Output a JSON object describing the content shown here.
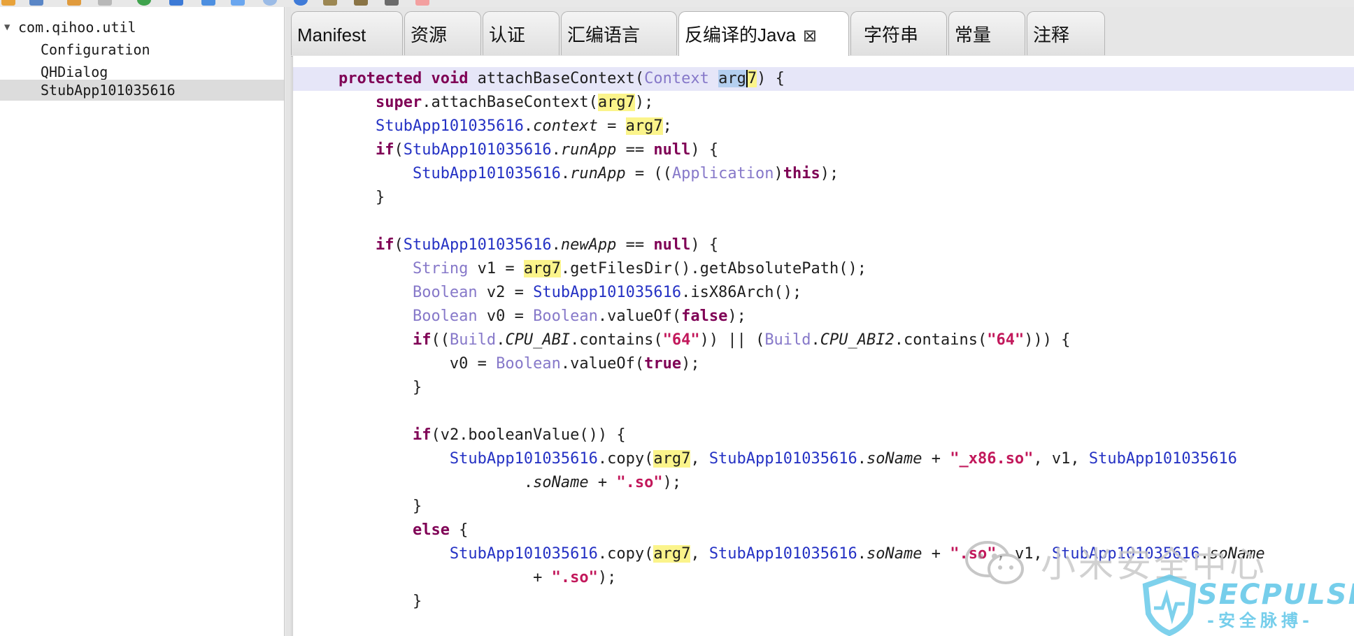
{
  "toolbar": {
    "icons": [
      "folder-icon",
      "save-icon",
      "pencil-icon",
      "clipboard-icon",
      "refresh-icon",
      "down-arrow-icon",
      "back-icon",
      "forward-icon",
      "info-icon",
      "info-icon",
      "tool-icon",
      "tool-icon",
      "settings-icon",
      "image-icon"
    ]
  },
  "tree": {
    "items": [
      {
        "label": "com.qihoo.util",
        "expanded": true
      },
      {
        "label": "Configuration"
      },
      {
        "label": "QHDialog"
      },
      {
        "label": "StubApp101035616",
        "selected": true
      }
    ]
  },
  "tabs": [
    {
      "label": "Manifest"
    },
    {
      "label": "资源"
    },
    {
      "label": "认证"
    },
    {
      "label": "汇编语言"
    },
    {
      "label": "反编译的Java",
      "active": true,
      "close_icon": "close-icon"
    },
    {
      "label": "字符串"
    },
    {
      "label": "常量"
    },
    {
      "label": "注释"
    }
  ],
  "code": {
    "lines": [
      {
        "tokens": [
          {
            "text": "            ",
            "c": ""
          }
        ]
      },
      {
        "tokens": [
          {
            "text": "    ",
            "c": ""
          },
          {
            "text": "protected",
            "c": "kw"
          },
          {
            "text": " ",
            "c": ""
          },
          {
            "text": "void",
            "c": "kw"
          },
          {
            "text": " attachBaseContext(",
            "c": ""
          },
          {
            "text": "Context",
            "c": "typ"
          },
          {
            "text": " ",
            "c": ""
          },
          {
            "text": "arg",
            "c": "sel"
          },
          {
            "text": "7",
            "c": "hl caret"
          },
          {
            "text": ") {",
            "c": ""
          }
        ],
        "current": true
      },
      {
        "tokens": [
          {
            "text": "        ",
            "c": ""
          },
          {
            "text": "super",
            "c": "kw"
          },
          {
            "text": ".attachBaseContext(",
            "c": ""
          },
          {
            "text": "arg7",
            "c": "hl"
          },
          {
            "text": ");",
            "c": ""
          }
        ]
      },
      {
        "tokens": [
          {
            "text": "        ",
            "c": ""
          },
          {
            "text": "StubApp101035616",
            "c": "cls"
          },
          {
            "text": ".",
            "c": ""
          },
          {
            "text": "context",
            "c": "fld"
          },
          {
            "text": " = ",
            "c": ""
          },
          {
            "text": "arg7",
            "c": "hl"
          },
          {
            "text": ";",
            "c": ""
          }
        ]
      },
      {
        "tokens": [
          {
            "text": "        ",
            "c": ""
          },
          {
            "text": "if",
            "c": "kw"
          },
          {
            "text": "(",
            "c": ""
          },
          {
            "text": "StubApp101035616",
            "c": "cls"
          },
          {
            "text": ".",
            "c": ""
          },
          {
            "text": "runApp",
            "c": "fld"
          },
          {
            "text": " == ",
            "c": ""
          },
          {
            "text": "null",
            "c": "kw"
          },
          {
            "text": ") {",
            "c": ""
          }
        ]
      },
      {
        "tokens": [
          {
            "text": "            ",
            "c": ""
          },
          {
            "text": "StubApp101035616",
            "c": "cls"
          },
          {
            "text": ".",
            "c": ""
          },
          {
            "text": "runApp",
            "c": "fld"
          },
          {
            "text": " = ((",
            "c": ""
          },
          {
            "text": "Application",
            "c": "typ"
          },
          {
            "text": ")",
            "c": ""
          },
          {
            "text": "this",
            "c": "kw"
          },
          {
            "text": ");",
            "c": ""
          }
        ]
      },
      {
        "tokens": [
          {
            "text": "        }",
            "c": ""
          }
        ]
      },
      {
        "tokens": [
          {
            "text": "",
            "c": ""
          }
        ]
      },
      {
        "tokens": [
          {
            "text": "        ",
            "c": ""
          },
          {
            "text": "if",
            "c": "kw"
          },
          {
            "text": "(",
            "c": ""
          },
          {
            "text": "StubApp101035616",
            "c": "cls"
          },
          {
            "text": ".",
            "c": ""
          },
          {
            "text": "newApp",
            "c": "fld"
          },
          {
            "text": " == ",
            "c": ""
          },
          {
            "text": "null",
            "c": "kw"
          },
          {
            "text": ") {",
            "c": ""
          }
        ]
      },
      {
        "tokens": [
          {
            "text": "            ",
            "c": ""
          },
          {
            "text": "String",
            "c": "typ"
          },
          {
            "text": " v1 = ",
            "c": ""
          },
          {
            "text": "arg7",
            "c": "hl"
          },
          {
            "text": ".getFilesDir().getAbsolutePath();",
            "c": ""
          }
        ]
      },
      {
        "tokens": [
          {
            "text": "            ",
            "c": ""
          },
          {
            "text": "Boolean",
            "c": "typ"
          },
          {
            "text": " v2 = ",
            "c": ""
          },
          {
            "text": "StubApp101035616",
            "c": "cls"
          },
          {
            "text": ".isX86Arch();",
            "c": ""
          }
        ]
      },
      {
        "tokens": [
          {
            "text": "            ",
            "c": ""
          },
          {
            "text": "Boolean",
            "c": "typ"
          },
          {
            "text": " v0 = ",
            "c": ""
          },
          {
            "text": "Boolean",
            "c": "typ"
          },
          {
            "text": ".valueOf(",
            "c": ""
          },
          {
            "text": "false",
            "c": "kw"
          },
          {
            "text": ");",
            "c": ""
          }
        ]
      },
      {
        "tokens": [
          {
            "text": "            ",
            "c": ""
          },
          {
            "text": "if",
            "c": "kw"
          },
          {
            "text": "((",
            "c": ""
          },
          {
            "text": "Build",
            "c": "typ"
          },
          {
            "text": ".",
            "c": ""
          },
          {
            "text": "CPU_ABI",
            "c": "fld"
          },
          {
            "text": ".contains(",
            "c": ""
          },
          {
            "text": "\"64\"",
            "c": "str"
          },
          {
            "text": ")) || (",
            "c": ""
          },
          {
            "text": "Build",
            "c": "typ"
          },
          {
            "text": ".",
            "c": ""
          },
          {
            "text": "CPU_ABI2",
            "c": "fld"
          },
          {
            "text": ".contains(",
            "c": ""
          },
          {
            "text": "\"64\"",
            "c": "str"
          },
          {
            "text": "))) {",
            "c": ""
          }
        ]
      },
      {
        "tokens": [
          {
            "text": "                v0 = ",
            "c": ""
          },
          {
            "text": "Boolean",
            "c": "typ"
          },
          {
            "text": ".valueOf(",
            "c": ""
          },
          {
            "text": "true",
            "c": "kw"
          },
          {
            "text": ");",
            "c": ""
          }
        ]
      },
      {
        "tokens": [
          {
            "text": "            }",
            "c": ""
          }
        ]
      },
      {
        "tokens": [
          {
            "text": "",
            "c": ""
          }
        ]
      },
      {
        "tokens": [
          {
            "text": "            ",
            "c": ""
          },
          {
            "text": "if",
            "c": "kw"
          },
          {
            "text": "(v2.booleanValue()) {",
            "c": ""
          }
        ]
      },
      {
        "tokens": [
          {
            "text": "                ",
            "c": ""
          },
          {
            "text": "StubApp101035616",
            "c": "cls"
          },
          {
            "text": ".copy(",
            "c": ""
          },
          {
            "text": "arg7",
            "c": "hl"
          },
          {
            "text": ", ",
            "c": ""
          },
          {
            "text": "StubApp101035616",
            "c": "cls"
          },
          {
            "text": ".",
            "c": ""
          },
          {
            "text": "soName",
            "c": "fld"
          },
          {
            "text": " + ",
            "c": ""
          },
          {
            "text": "\"_x86.so\"",
            "c": "str"
          },
          {
            "text": ", v1, ",
            "c": ""
          },
          {
            "text": "StubApp101035616",
            "c": "cls"
          }
        ]
      },
      {
        "tokens": [
          {
            "text": "                        .",
            "c": ""
          },
          {
            "text": "soName",
            "c": "fld"
          },
          {
            "text": " + ",
            "c": ""
          },
          {
            "text": "\".so\"",
            "c": "str"
          },
          {
            "text": ");",
            "c": ""
          }
        ]
      },
      {
        "tokens": [
          {
            "text": "            }",
            "c": ""
          }
        ]
      },
      {
        "tokens": [
          {
            "text": "            ",
            "c": ""
          },
          {
            "text": "else",
            "c": "kw"
          },
          {
            "text": " {",
            "c": ""
          }
        ]
      },
      {
        "tokens": [
          {
            "text": "                ",
            "c": ""
          },
          {
            "text": "StubApp101035616",
            "c": "cls"
          },
          {
            "text": ".copy(",
            "c": ""
          },
          {
            "text": "arg7",
            "c": "hl"
          },
          {
            "text": ", ",
            "c": ""
          },
          {
            "text": "StubApp101035616",
            "c": "cls"
          },
          {
            "text": ".",
            "c": ""
          },
          {
            "text": "soName",
            "c": "fld"
          },
          {
            "text": " + ",
            "c": ""
          },
          {
            "text": "\".so\"",
            "c": "str"
          },
          {
            "text": ", v1, ",
            "c": ""
          },
          {
            "text": "StubApp101035616",
            "c": "cls"
          },
          {
            "text": ".",
            "c": ""
          },
          {
            "text": "soName",
            "c": "fld"
          }
        ]
      },
      {
        "tokens": [
          {
            "text": "                         + ",
            "c": ""
          },
          {
            "text": "\".so\"",
            "c": "str"
          },
          {
            "text": ");",
            "c": ""
          }
        ]
      },
      {
        "tokens": [
          {
            "text": "            }",
            "c": ""
          }
        ]
      }
    ]
  },
  "watermark": {
    "wechat_text": "小米安全中心",
    "brand": "SECPULSE",
    "brand_sub": "-安全脉搏-"
  },
  "colors": {
    "keyword": "#7f0055",
    "class": "#2431c4",
    "type": "#8678c9",
    "string": "#c2185b",
    "highlight": "#fbf48b",
    "current_line": "#e6e6f8"
  }
}
